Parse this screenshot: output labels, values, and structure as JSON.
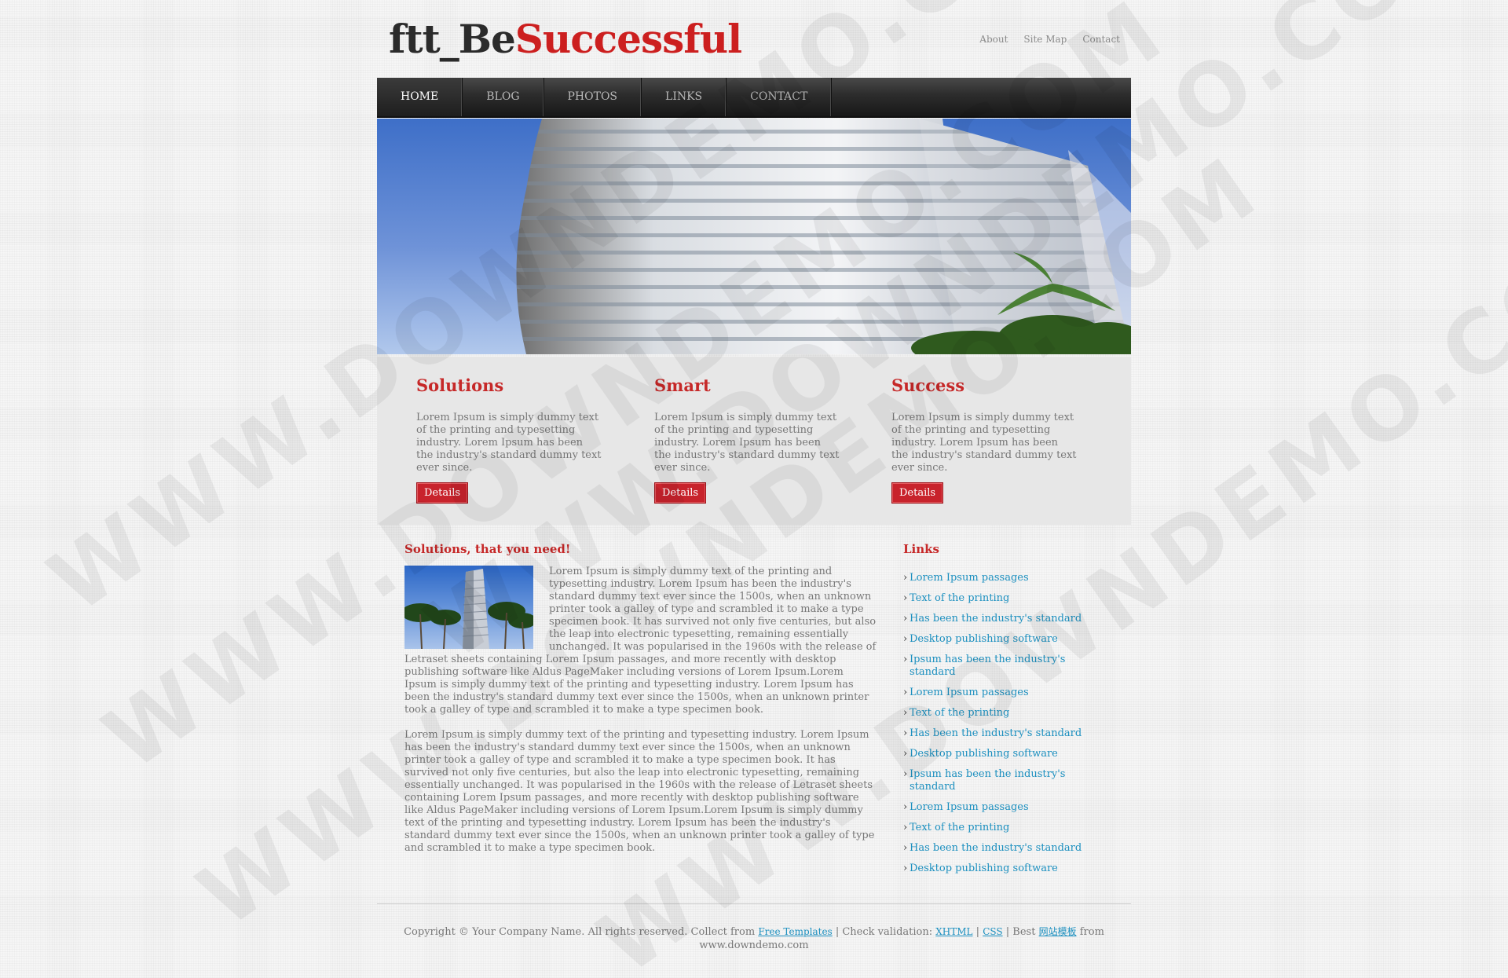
{
  "site": {
    "logo_part1": "ftt_Be",
    "logo_part2": "Successful",
    "top_links": [
      "About",
      "Site Map",
      "Contact"
    ],
    "colors": {
      "accent_red": "#c62828",
      "link_blue": "#1b8fbf",
      "nav_dark": "#2c2c2c"
    }
  },
  "nav": {
    "items": [
      "HOME",
      "BLOG",
      "PHOTOS",
      "LINKS",
      "CONTACT"
    ],
    "active": "HOME"
  },
  "watermark": "WWW.DOWNDEMO.COM",
  "features": [
    {
      "title": "Solutions",
      "text": "Lorem Ipsum is simply dummy text of the printing and typesetting industry. Lorem Ipsum has been the industry's standard dummy text ever since.",
      "button": "Details"
    },
    {
      "title": "Smart",
      "text": "Lorem Ipsum is simply dummy text of the printing and typesetting industry. Lorem Ipsum has been the industry's standard dummy text ever since.",
      "button": "Details"
    },
    {
      "title": "Success",
      "text": "Lorem Ipsum is simply dummy text of the printing and typesetting industry. Lorem Ipsum has been the industry's standard dummy text ever since.",
      "button": "Details"
    }
  ],
  "main": {
    "heading": "Solutions, that you need!",
    "paragraph1": "Lorem Ipsum is simply dummy text of the printing and typesetting industry. Lorem Ipsum has been the industry's standard dummy text ever since the 1500s, when an unknown printer took a galley of type and scrambled it to make a type specimen book. It has survived not only five centuries, but also the leap into electronic typesetting, remaining essentially unchanged. It was popularised in the 1960s with the release of Letraset sheets containing Lorem Ipsum passages, and more recently with desktop publishing software like Aldus PageMaker including versions of Lorem Ipsum.Lorem Ipsum is simply dummy text of the printing and typesetting industry. Lorem Ipsum has been the industry's standard dummy text ever since the 1500s, when an unknown printer took a galley of type and scrambled it to make a type specimen book.",
    "paragraph2": "Lorem Ipsum is simply dummy text of the printing and typesetting industry. Lorem Ipsum has been the industry's standard dummy text ever since the 1500s, when an unknown printer took a galley of type and scrambled it to make a type specimen book. It has survived not only five centuries, but also the leap into electronic typesetting, remaining essentially unchanged. It was popularised in the 1960s with the release of Letraset sheets containing Lorem Ipsum passages, and more recently with desktop publishing software like Aldus PageMaker including versions of Lorem Ipsum.Lorem Ipsum is simply dummy text of the printing and typesetting industry. Lorem Ipsum has been the industry's standard dummy text ever since the 1500s, when an unknown printer took a galley of type and scrambled it to make a type specimen book."
  },
  "sidebar": {
    "heading": "Links",
    "links": [
      "Lorem Ipsum passages",
      "Text of the printing",
      "Has been the industry's standard",
      "Desktop publishing software",
      "Ipsum has been the industry's standard",
      "Lorem Ipsum passages",
      "Text of the printing",
      "Has been the industry's standard",
      "Desktop publishing software",
      "Ipsum has been the industry's standard",
      "Lorem Ipsum passages",
      "Text of the printing",
      "Has been the industry's standard",
      "Desktop publishing software"
    ]
  },
  "footer": {
    "copyright": "Copyright © Your Company Name. All rights reserved. Collect from",
    "free_templates": "Free Templates",
    "check_validation": "| Check validation:",
    "xhtml": "XHTML",
    "sep": "|",
    "css": "CSS",
    "best": "| Best",
    "cn_link": "网站模板",
    "from": "from",
    "domain": "www.downdemo.com"
  }
}
